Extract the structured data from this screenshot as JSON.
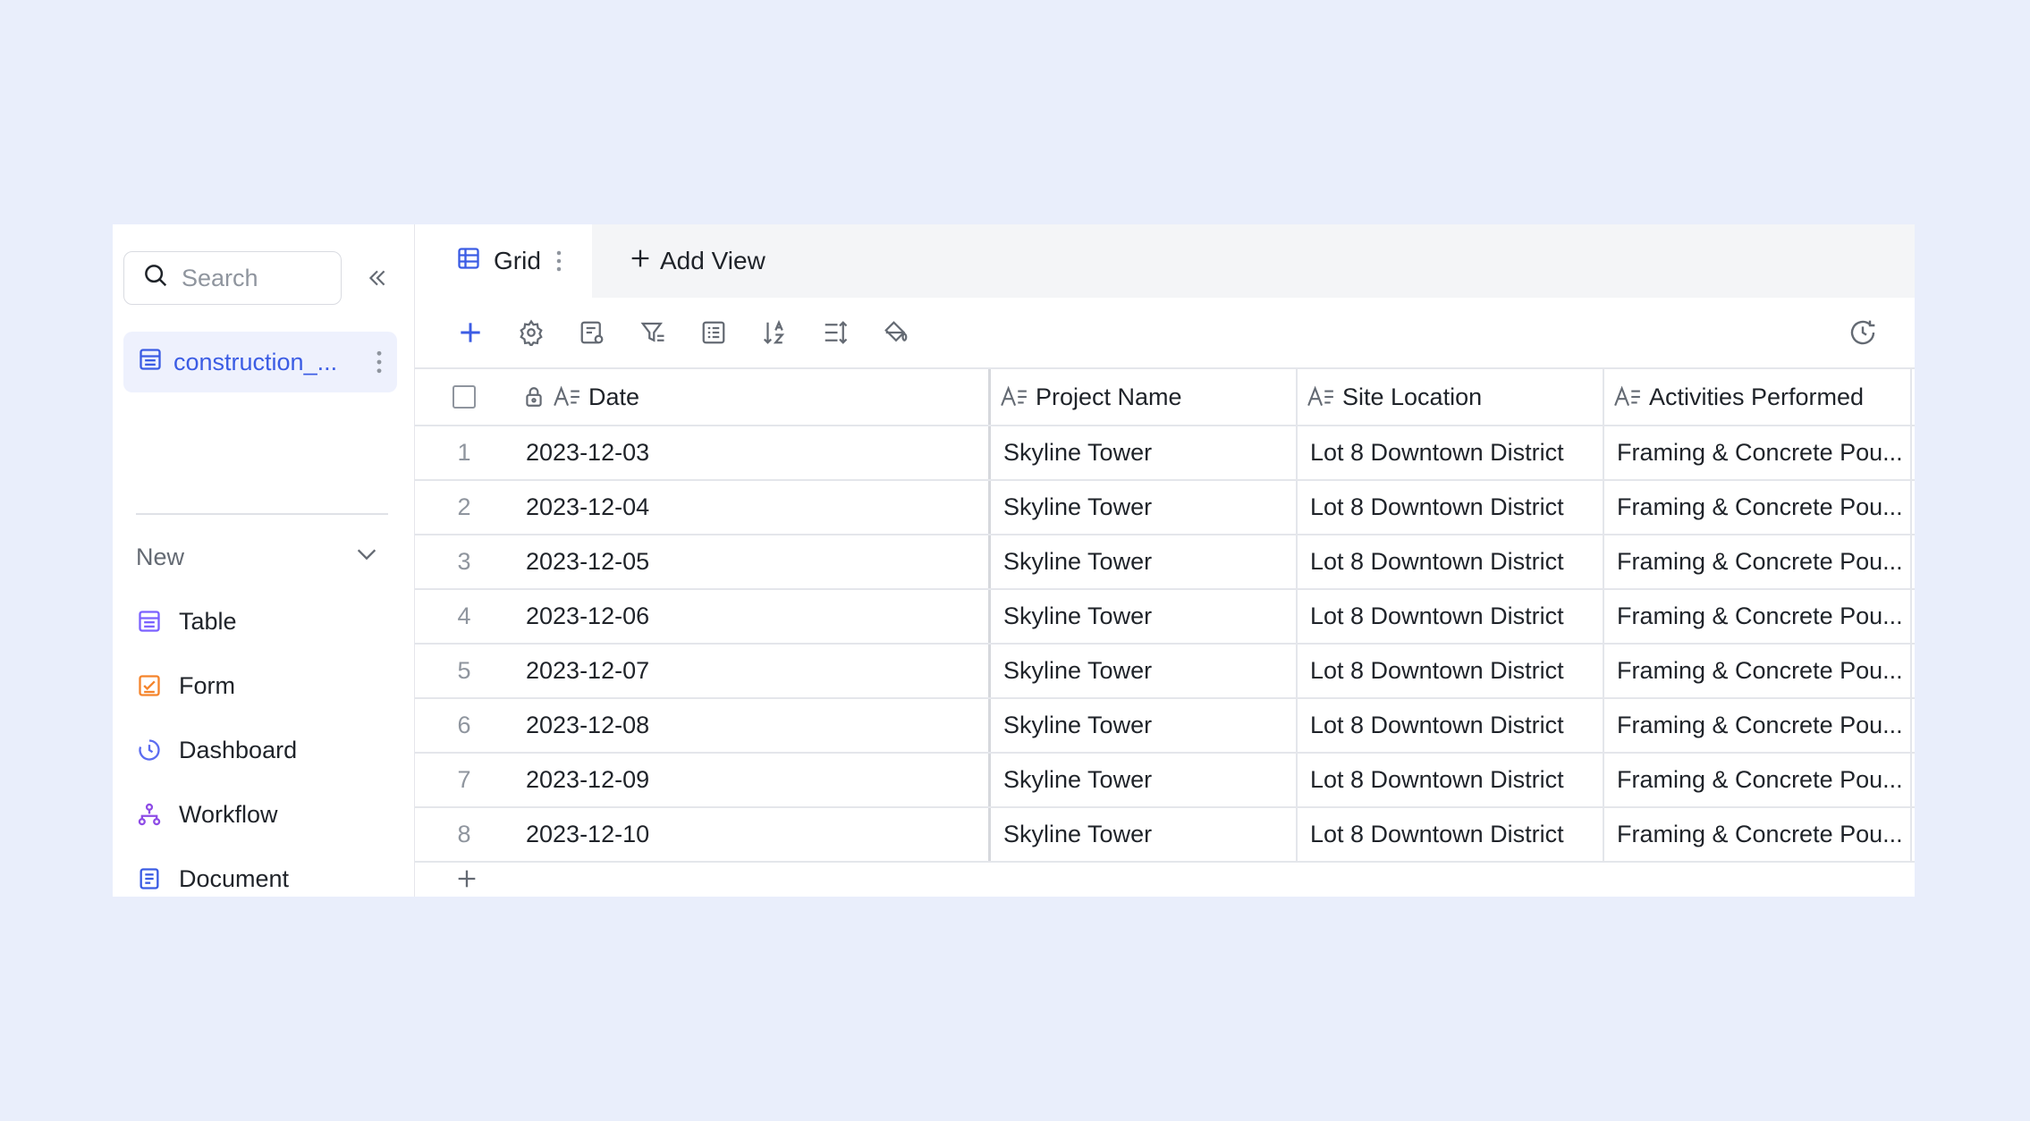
{
  "sidebar": {
    "search_placeholder": "Search",
    "base_name": "construction_...",
    "new_label": "New",
    "create_items": [
      {
        "label": "Table",
        "icon": "table-icon",
        "color": "#7b61ff"
      },
      {
        "label": "Form",
        "icon": "form-icon",
        "color": "#f5842b"
      },
      {
        "label": "Dashboard",
        "icon": "dashboard-icon",
        "color": "#5b6cf0"
      },
      {
        "label": "Workflow",
        "icon": "workflow-icon",
        "color": "#8e4ce6"
      },
      {
        "label": "Document",
        "icon": "document-icon",
        "color": "#3b5ce4"
      }
    ]
  },
  "tabs": {
    "grid_label": "Grid",
    "add_view_label": "Add View"
  },
  "toolbar": {
    "icons": [
      "add-record-icon",
      "settings-icon",
      "field-config-icon",
      "filter-icon",
      "group-icon",
      "sort-icon",
      "row-height-icon",
      "fill-color-icon"
    ],
    "right_icon": "history-icon",
    "accent": "#3b5ce4"
  },
  "table": {
    "columns": [
      "Date",
      "Project Name",
      "Site Location",
      "Activities Performed"
    ],
    "rows": [
      {
        "idx": "1",
        "date": "2023-12-03",
        "project": "Skyline Tower",
        "site": "Lot 8 Downtown District",
        "activities": "Framing & Concrete Pou..."
      },
      {
        "idx": "2",
        "date": "2023-12-04",
        "project": "Skyline Tower",
        "site": "Lot 8 Downtown District",
        "activities": "Framing & Concrete Pou..."
      },
      {
        "idx": "3",
        "date": "2023-12-05",
        "project": "Skyline Tower",
        "site": "Lot 8 Downtown District",
        "activities": "Framing & Concrete Pou..."
      },
      {
        "idx": "4",
        "date": "2023-12-06",
        "project": "Skyline Tower",
        "site": "Lot 8 Downtown District",
        "activities": "Framing & Concrete Pou..."
      },
      {
        "idx": "5",
        "date": "2023-12-07",
        "project": "Skyline Tower",
        "site": "Lot 8 Downtown District",
        "activities": "Framing & Concrete Pou..."
      },
      {
        "idx": "6",
        "date": "2023-12-08",
        "project": "Skyline Tower",
        "site": "Lot 8 Downtown District",
        "activities": "Framing & Concrete Pou..."
      },
      {
        "idx": "7",
        "date": "2023-12-09",
        "project": "Skyline Tower",
        "site": "Lot 8 Downtown District",
        "activities": "Framing & Concrete Pou..."
      },
      {
        "idx": "8",
        "date": "2023-12-10",
        "project": "Skyline Tower",
        "site": "Lot 8 Downtown District",
        "activities": "Framing & Concrete Pou..."
      }
    ]
  }
}
